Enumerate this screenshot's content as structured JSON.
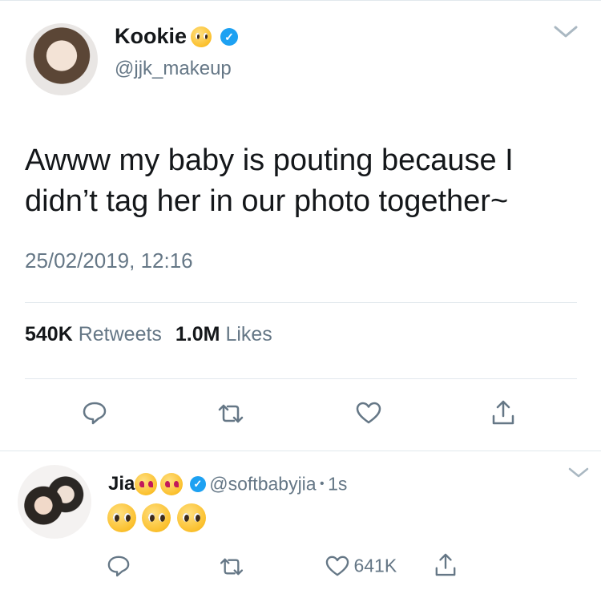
{
  "main_tweet": {
    "author_name": "Kookie",
    "handle": "@jjk_makeup",
    "text_line1": "Awww my baby is pouting because I",
    "text_line2": "didn’t tag her in our photo together~",
    "timestamp": "25/02/2019, 12:16",
    "retweets_count": "540K",
    "retweets_label": "Retweets",
    "likes_count": "1.0M",
    "likes_label": "Likes"
  },
  "reply": {
    "author_name": "Jia",
    "handle": "@softbabyjia",
    "separator": "•",
    "time": "1s",
    "likes_count": "641K"
  },
  "icons": {
    "verified": "verified-badge-icon",
    "menu": "chevron-down-icon",
    "reply": "reply-icon",
    "retweet": "retweet-icon",
    "like": "heart-icon",
    "share": "share-icon"
  },
  "colors": {
    "text": "#14171a",
    "muted": "#657786",
    "verified": "#1da1f2",
    "divider": "#e1e8ed"
  }
}
